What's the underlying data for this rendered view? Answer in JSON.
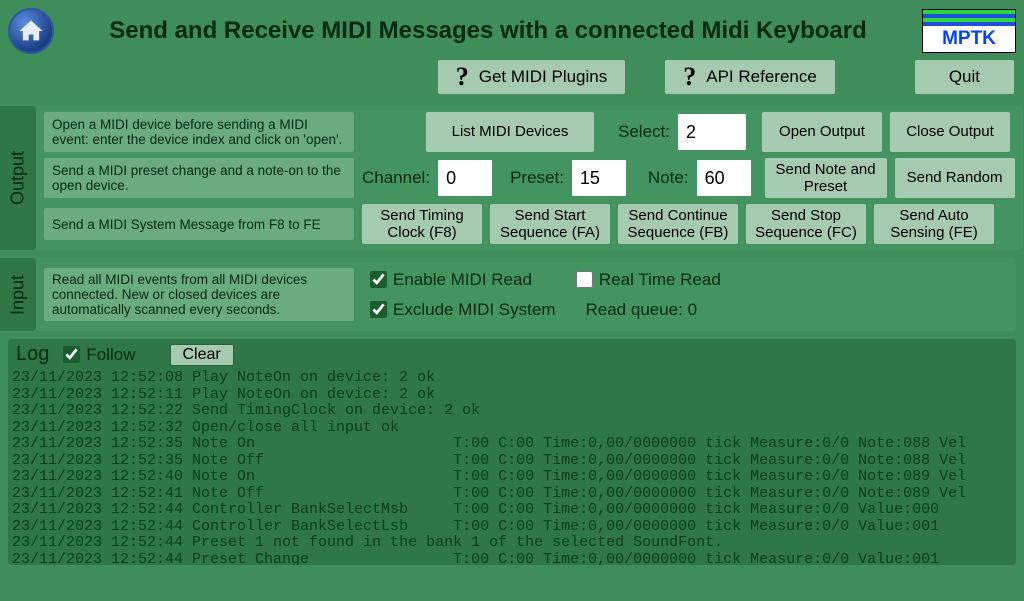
{
  "header": {
    "title": "Send and Receive MIDI Messages with a connected Midi Keyboard",
    "logo_text": "MPTK",
    "stripe_colors": [
      "#2bd83b",
      "#1e4de0",
      "#2bd83b",
      "#1e4de0"
    ]
  },
  "topbuttons": {
    "plugins": "Get MIDI Plugins",
    "api": "API Reference",
    "quit": "Quit"
  },
  "output": {
    "panel_label": "Output",
    "row1": {
      "desc": "Open a MIDI device before sending a MIDI event: enter the device index and click on 'open'.",
      "list_btn": "List MIDI Devices",
      "select_lbl": "Select:",
      "select_val": "2",
      "open_btn": "Open Output",
      "close_btn": "Close Output"
    },
    "row2": {
      "desc": "Send a MIDI preset change and a note-on to the open device.",
      "channel_lbl": "Channel:",
      "channel_val": "0",
      "preset_lbl": "Preset:",
      "preset_val": "15",
      "note_lbl": "Note:",
      "note_val": "60",
      "send_note_btn": "Send Note and Preset",
      "send_random_btn": "Send Random"
    },
    "row3": {
      "desc": "Send a MIDI System Message from F8 to FE",
      "b1": "Send Timing Clock (F8)",
      "b2": "Send Start Sequence (FA)",
      "b3": "Send Continue Sequence (FB)",
      "b4": "Send Stop Sequence (FC)",
      "b5": "Send Auto Sensing (FE)"
    }
  },
  "input": {
    "panel_label": "Input",
    "desc": "Read all MIDI events from all MIDI devices connected. New or closed devices are automatically scanned every seconds.",
    "enable_lbl": "Enable MIDI Read",
    "enable_checked": true,
    "realtime_lbl": "Real Time Read",
    "realtime_checked": false,
    "exclude_lbl": "Exclude MIDI System",
    "exclude_checked": true,
    "queue_lbl": "Read queue: 0"
  },
  "log": {
    "title": "Log",
    "follow_lbl": "Follow",
    "follow_checked": true,
    "clear_btn": "Clear",
    "lines": [
      "23/11/2023 12:52:08 Play NoteOn on device: 2 ok",
      "23/11/2023 12:52:11 Play NoteOn on device: 2 ok",
      "23/11/2023 12:52:22 Send TimingClock on device: 2 ok",
      "23/11/2023 12:52:32 Open/close all input ok",
      "23/11/2023 12:52:35 Note On                      T:00 C:00 Time:0,00/0000000 tick Measure:0/0 Note:088 Vel",
      "23/11/2023 12:52:35 Note Off                     T:00 C:00 Time:0,00/0000000 tick Measure:0/0 Note:088 Vel",
      "23/11/2023 12:52:40 Note On                      T:00 C:00 Time:0,00/0000000 tick Measure:0/0 Note:089 Vel",
      "23/11/2023 12:52:41 Note Off                     T:00 C:00 Time:0,00/0000000 tick Measure:0/0 Note:089 Vel",
      "23/11/2023 12:52:44 Controller BankSelectMsb     T:00 C:00 Time:0,00/0000000 tick Measure:0/0 Value:000",
      "23/11/2023 12:52:44 Controller BankSelectLsb     T:00 C:00 Time:0,00/0000000 tick Measure:0/0 Value:001",
      "23/11/2023 12:52:44 Preset 1 not found in the bank 1 of the selected SoundFont.",
      "23/11/2023 12:52:44 Preset Change                T:00 C:00 Time:0,00/0000000 tick Measure:0/0 Value:001"
    ]
  }
}
